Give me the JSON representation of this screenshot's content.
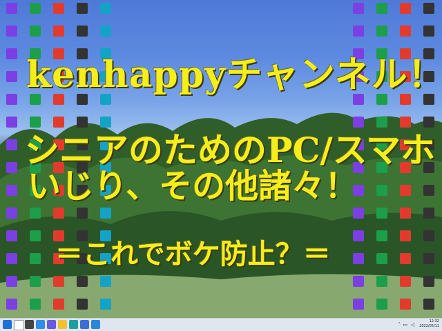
{
  "banner": {
    "line1": "kenhappyチャンネル！",
    "line2": "シニアのためのPC/スマホ",
    "line3": "いじり、その他諸々！",
    "line4": "＝これでボケ防止？＝",
    "color": "#f6ee1b"
  },
  "taskbar": {
    "time": "12:32",
    "date": "2022/05/11",
    "icons": [
      "start-icon",
      "search-icon",
      "task-view-icon",
      "widgets-icon",
      "chat-icon",
      "file-explorer-icon",
      "edge-icon",
      "store-icon",
      "mail-icon"
    ],
    "tray_icons": [
      "chevron-up-icon",
      "network-icon",
      "volume-icon"
    ]
  },
  "desktop_icon_colors": [
    "#e23b2e",
    "#2b7de9",
    "#1c9e4a",
    "#f0b323",
    "#7b3fe4",
    "#ffffff",
    "#14a3c7",
    "#e86a1c",
    "#333333",
    "#c9c9c9"
  ]
}
